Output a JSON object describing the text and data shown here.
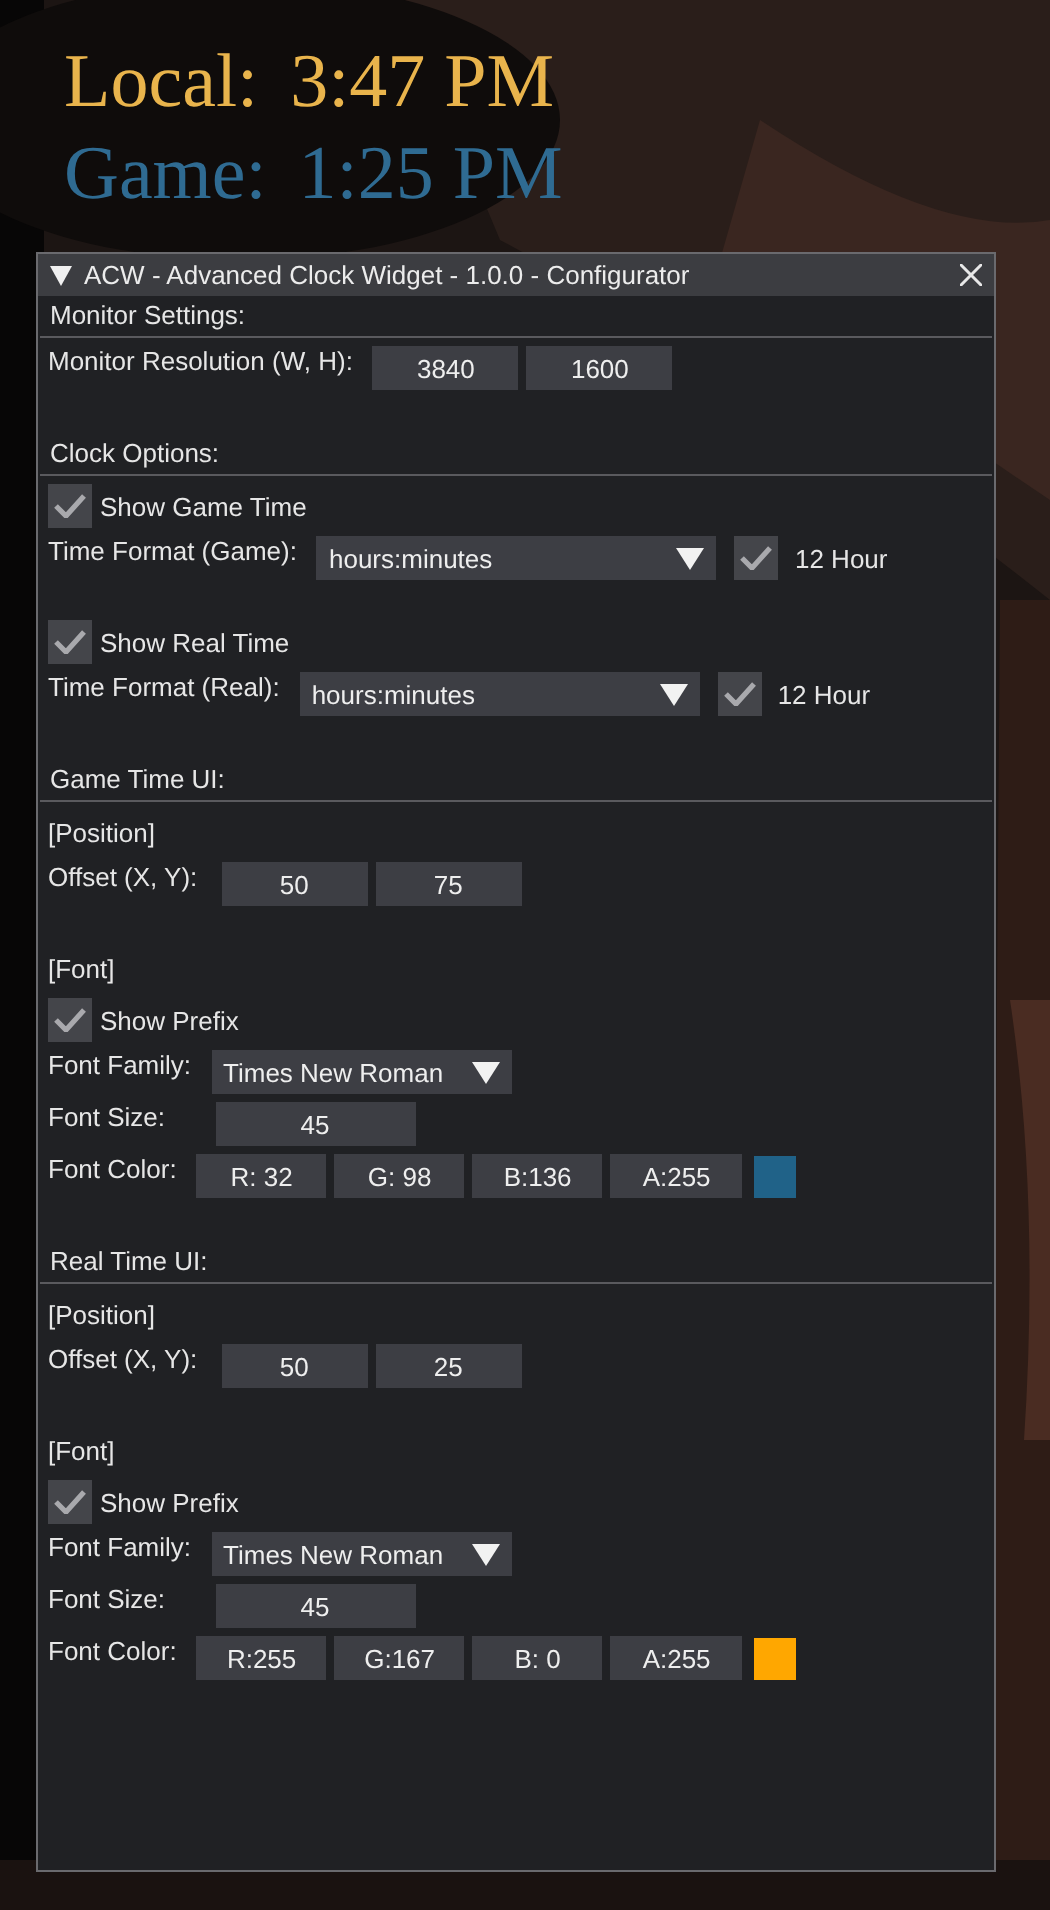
{
  "clock_overlay": [
    {
      "prefix": "Local:",
      "time": "3:47 PM",
      "color": "#e9b44c"
    },
    {
      "prefix": "Game:",
      "time": "1:25 PM",
      "color": "#2f6b92"
    }
  ],
  "window": {
    "title": "ACW - Advanced Clock Widget - 1.0.0 - Configurator",
    "expanded": true
  },
  "sections": [
    {
      "heading": "Monitor Settings:",
      "groups": [
        [
          {
            "kind": "pair",
            "label": "Monitor Resolution (W, H):",
            "values": [
              "3840",
              "1600"
            ]
          }
        ]
      ]
    },
    {
      "heading": "Clock Options:",
      "groups": [
        [
          {
            "kind": "checkbox",
            "label": "Show Game Time",
            "checked": true
          },
          {
            "kind": "combo",
            "label": "Time Format (Game):",
            "value": "hours:minutes",
            "toggle": {
              "label": "12 Hour",
              "checked": true
            }
          }
        ],
        [
          {
            "kind": "checkbox",
            "label": "Show Real Time",
            "checked": true
          },
          {
            "kind": "combo",
            "label": "Time Format (Real):",
            "value": "hours:minutes",
            "toggle": {
              "label": "12 Hour",
              "checked": true
            }
          }
        ]
      ]
    },
    {
      "heading": "Game Time UI:",
      "groups": [
        [
          {
            "kind": "subheading",
            "text": "[Position]"
          },
          {
            "kind": "pair",
            "label": "Offset (X, Y):",
            "values": [
              "50",
              "75"
            ]
          }
        ],
        [
          {
            "kind": "subheading",
            "text": "[Font]"
          },
          {
            "kind": "checkbox",
            "label": "Show Prefix",
            "checked": true
          },
          {
            "kind": "select",
            "label": "Font Family:",
            "value": "Times New Roman"
          },
          {
            "kind": "input",
            "label": "Font Size:",
            "value": "45"
          },
          {
            "kind": "color",
            "label": "Font Color:",
            "values": [
              "R: 32",
              "G: 98",
              "B:136",
              "A:255"
            ],
            "color": "#206288"
          }
        ]
      ]
    },
    {
      "heading": "Real Time UI:",
      "groups": [
        [
          {
            "kind": "subheading",
            "text": "[Position]"
          },
          {
            "kind": "pair",
            "label": "Offset (X, Y):",
            "values": [
              "50",
              "25"
            ]
          }
        ],
        [
          {
            "kind": "subheading",
            "text": "[Font]"
          },
          {
            "kind": "checkbox",
            "label": "Show Prefix",
            "checked": true
          },
          {
            "kind": "select",
            "label": "Font Family:",
            "value": "Times New Roman"
          },
          {
            "kind": "input",
            "label": "Font Size:",
            "value": "45"
          },
          {
            "kind": "color",
            "label": "Font Color:",
            "values": [
              "R:255",
              "G:167",
              "B:  0",
              "A:255"
            ],
            "color": "#ffa700"
          }
        ]
      ]
    }
  ]
}
